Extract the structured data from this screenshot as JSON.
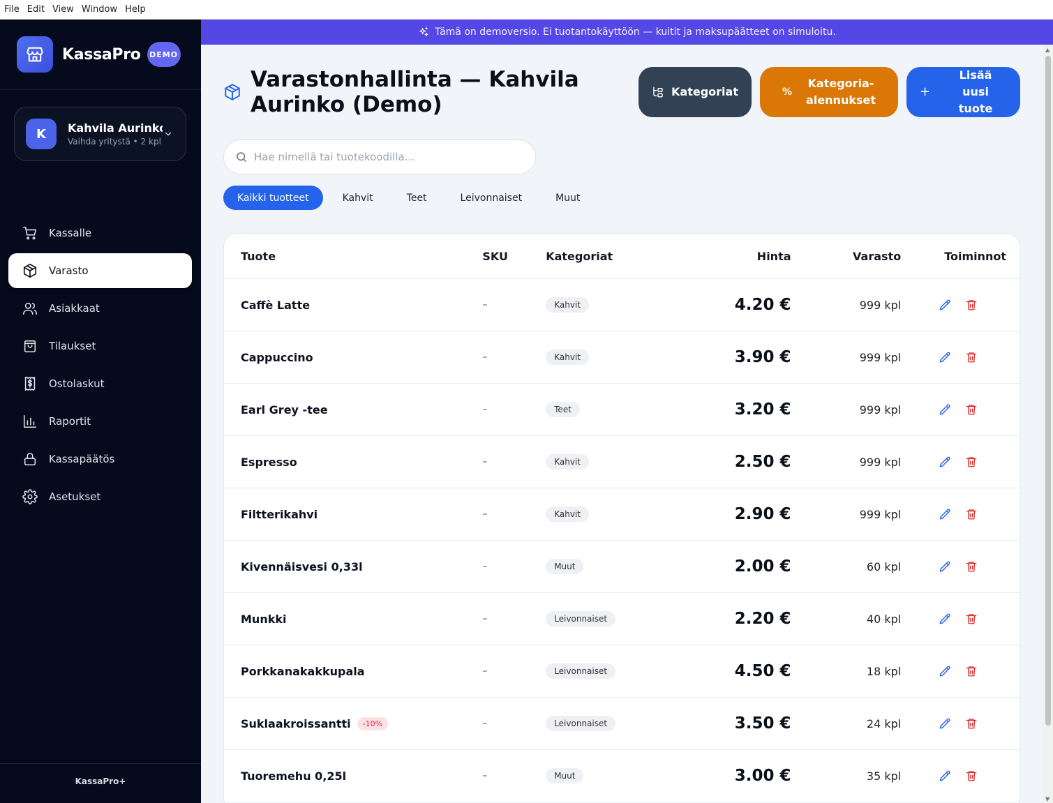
{
  "menubar": [
    "File",
    "Edit",
    "View",
    "Window",
    "Help"
  ],
  "brand": {
    "name": "KassaPro",
    "badge": "DEMO"
  },
  "company": {
    "avatar": "K",
    "name": "Kahvila Aurinko (Demo)",
    "sub": "Vaihda yritystä • 2 kpl"
  },
  "nav": [
    {
      "label": "Kassalle",
      "icon": "cart-icon",
      "active": false
    },
    {
      "label": "Varasto",
      "icon": "package-icon",
      "active": true
    },
    {
      "label": "Asiakkaat",
      "icon": "users-icon",
      "active": false
    },
    {
      "label": "Tilaukset",
      "icon": "shopping-bag-icon",
      "active": false
    },
    {
      "label": "Ostolaskut",
      "icon": "invoice-icon",
      "active": false
    },
    {
      "label": "Raportit",
      "icon": "bar-chart-icon",
      "active": false
    },
    {
      "label": "Kassapäätös",
      "icon": "lock-icon",
      "active": false
    },
    {
      "label": "Asetukset",
      "icon": "gear-icon",
      "active": false
    }
  ],
  "sidebar_footer": "KassaPro+",
  "banner": "Tämä on demoversio. Ei tuotantokäyttöön — kuitit ja maksupäätteet on simuloitu.",
  "page": {
    "title": "Varastonhallinta — Kahvila Aurinko (Demo)",
    "buttons": {
      "categories": "Kategoriat",
      "category_discounts": "Kategoria-alennukset",
      "category_discounts_icon": "%",
      "add_product": "Lisää uusi tuote",
      "add_product_icon": "+"
    },
    "search_placeholder": "Hae nimellä tai tuotekoodilla..."
  },
  "tabs": [
    {
      "label": "Kaikki tuotteet",
      "active": true
    },
    {
      "label": "Kahvit",
      "active": false
    },
    {
      "label": "Teet",
      "active": false
    },
    {
      "label": "Leivonnaiset",
      "active": false
    },
    {
      "label": "Muut",
      "active": false
    }
  ],
  "table": {
    "headers": {
      "product": "Tuote",
      "sku": "SKU",
      "categories": "Kategoriat",
      "price": "Hinta",
      "stock": "Varasto",
      "actions": "Toiminnot"
    },
    "rows": [
      {
        "name": "Caffè Latte",
        "discount": "",
        "sku": "–",
        "category": "Kahvit",
        "price": "4.20 €",
        "stock": "999 kpl"
      },
      {
        "name": "Cappuccino",
        "discount": "",
        "sku": "–",
        "category": "Kahvit",
        "price": "3.90 €",
        "stock": "999 kpl"
      },
      {
        "name": "Earl Grey -tee",
        "discount": "",
        "sku": "–",
        "category": "Teet",
        "price": "3.20 €",
        "stock": "999 kpl"
      },
      {
        "name": "Espresso",
        "discount": "",
        "sku": "–",
        "category": "Kahvit",
        "price": "2.50 €",
        "stock": "999 kpl"
      },
      {
        "name": "Filtterikahvi",
        "discount": "",
        "sku": "–",
        "category": "Kahvit",
        "price": "2.90 €",
        "stock": "999 kpl"
      },
      {
        "name": "Kivennäisvesi 0,33l",
        "discount": "",
        "sku": "–",
        "category": "Muut",
        "price": "2.00 €",
        "stock": "60 kpl"
      },
      {
        "name": "Munkki",
        "discount": "",
        "sku": "–",
        "category": "Leivonnaiset",
        "price": "2.20 €",
        "stock": "40 kpl"
      },
      {
        "name": "Porkkanakakkupala",
        "discount": "",
        "sku": "–",
        "category": "Leivonnaiset",
        "price": "4.50 €",
        "stock": "18 kpl"
      },
      {
        "name": "Suklaakroissantti",
        "discount": "-10%",
        "sku": "–",
        "category": "Leivonnaiset",
        "price": "3.50 €",
        "stock": "24 kpl"
      },
      {
        "name": "Tuoremehu 0,25l",
        "discount": "",
        "sku": "–",
        "category": "Muut",
        "price": "3.00 €",
        "stock": "35 kpl"
      }
    ]
  },
  "colors": {
    "sidebar": "#050b1c",
    "banner": "#5546e6",
    "primary": "#2563eb",
    "discount_button": "#da7707",
    "category_button": "#334155",
    "delete": "#dc2626"
  }
}
